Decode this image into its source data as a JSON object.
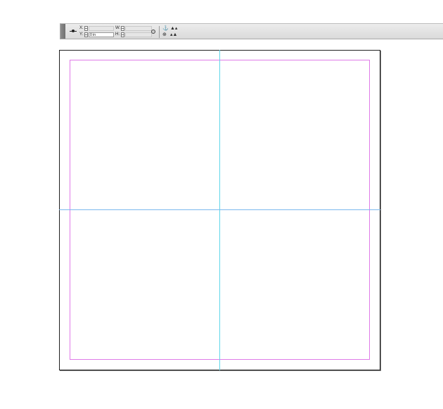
{
  "control_panel": {
    "x_label": "X:",
    "y_label": "Y:",
    "w_label": "W:",
    "h_label": "H:",
    "y_value": "0 in",
    "x_value": "",
    "w_value": "",
    "h_value": "",
    "icons": [
      "reference-point-icon",
      "constrain-proportions-icon",
      "flip-horizontal-icon",
      "flip-vertical-icon",
      "rotate-icon",
      "shear-icon"
    ]
  },
  "colors": {
    "margin_guide": "#e07be8",
    "vertical_guide": "#5fd6ea",
    "horizontal_guide": "#7ab8ef",
    "page_border": "#1f1f1f"
  }
}
